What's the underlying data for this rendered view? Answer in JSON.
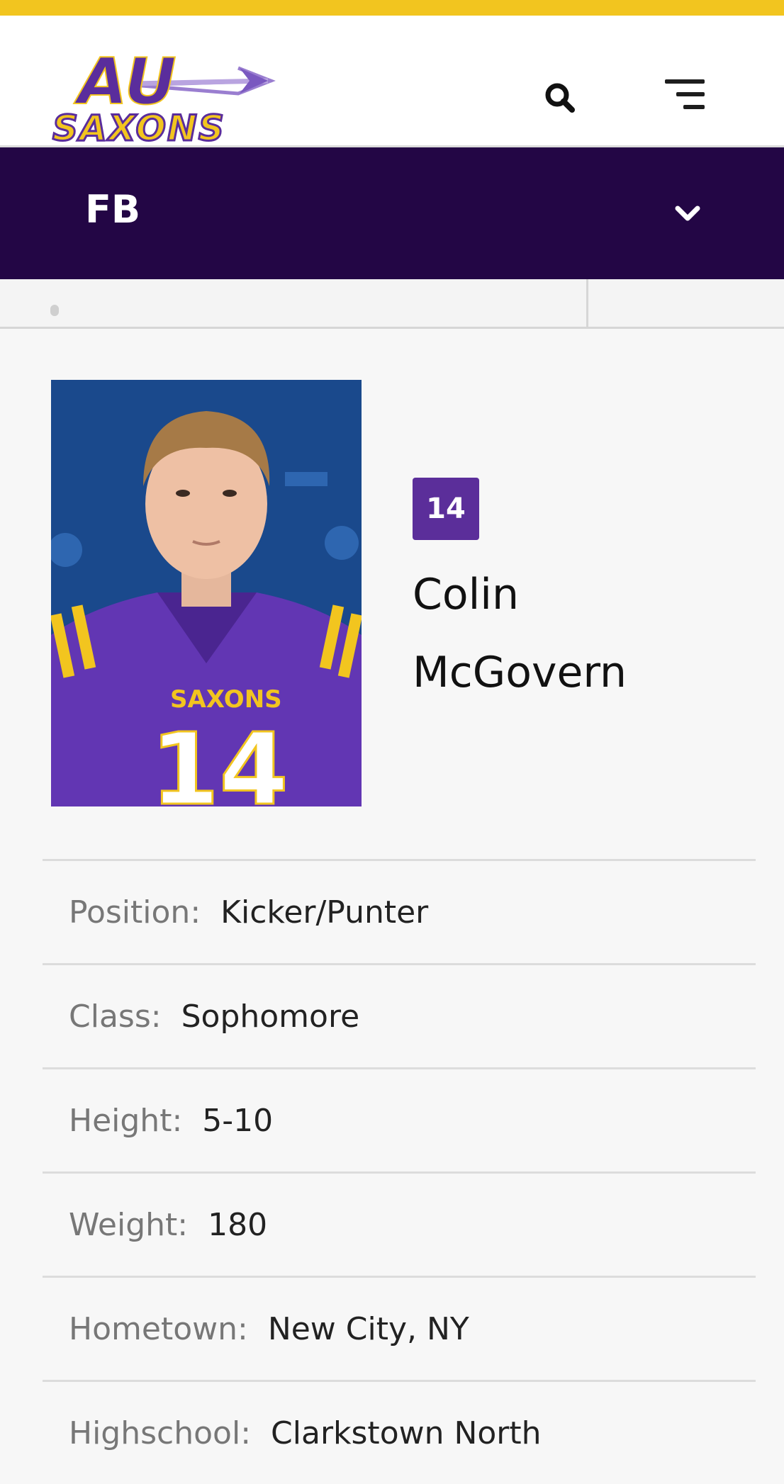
{
  "header": {
    "logo_text_top": "AU",
    "logo_text_bottom": "SAXONS",
    "search_icon": "search-icon",
    "menu_icon": "hamburger-menu-icon"
  },
  "sport": {
    "label": "FB",
    "toggle_icon": "chevron-down-icon"
  },
  "player": {
    "number": "14",
    "first_name": "Colin",
    "last_name": "McGovern",
    "photo_jersey_text": "SAXONS",
    "photo_jersey_number": "14"
  },
  "bio": [
    {
      "label": "Position:",
      "value": "Kicker/Punter"
    },
    {
      "label": "Class:",
      "value": "Sophomore"
    },
    {
      "label": "Height:",
      "value": "5-10"
    },
    {
      "label": "Weight:",
      "value": "180"
    },
    {
      "label": "Hometown:",
      "value": "New City, NY"
    },
    {
      "label": "Highschool:",
      "value": "Clarkstown North"
    }
  ],
  "colors": {
    "topbar": "#f2c51f",
    "sportbar": "#230645",
    "jersey_badge": "#5b2e9a",
    "logo_purple": "#5a2d9c",
    "logo_gold": "#f2c51f"
  }
}
